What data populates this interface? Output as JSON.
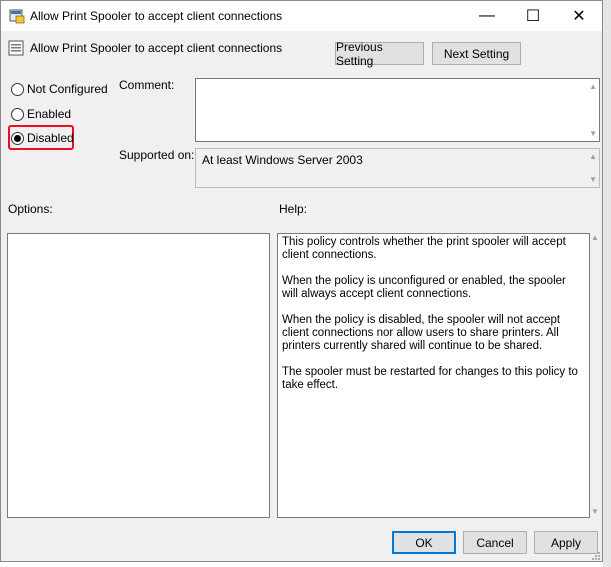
{
  "window": {
    "title": "Allow Print Spooler to accept client connections",
    "controls": {
      "minimize": "—",
      "maximize": "☐",
      "close": "✕"
    }
  },
  "header": {
    "setting_name": "Allow Print Spooler to accept client connections",
    "previous_setting": "Previous Setting",
    "next_setting": "Next Setting"
  },
  "state": {
    "options": [
      {
        "label": "Not Configured",
        "checked": false
      },
      {
        "label": "Enabled",
        "checked": false
      },
      {
        "label": "Disabled",
        "checked": true
      }
    ],
    "highlight_color": "#e81123"
  },
  "comment": {
    "label": "Comment:",
    "value": ""
  },
  "supported_on": {
    "label": "Supported on:",
    "value": "At least Windows Server 2003"
  },
  "options_panel": {
    "label": "Options:"
  },
  "help_panel": {
    "label": "Help:",
    "paragraphs": [
      "This policy controls whether the print spooler will accept client connections.",
      "When the policy is unconfigured or enabled, the spooler will always accept client connections.",
      "When the policy is disabled, the spooler will not accept client connections nor allow users to share printers.  All printers currently shared will continue to be shared.",
      "The spooler must be restarted for changes to this policy to take effect."
    ]
  },
  "buttons": {
    "ok": "OK",
    "cancel": "Cancel",
    "apply": "Apply"
  }
}
